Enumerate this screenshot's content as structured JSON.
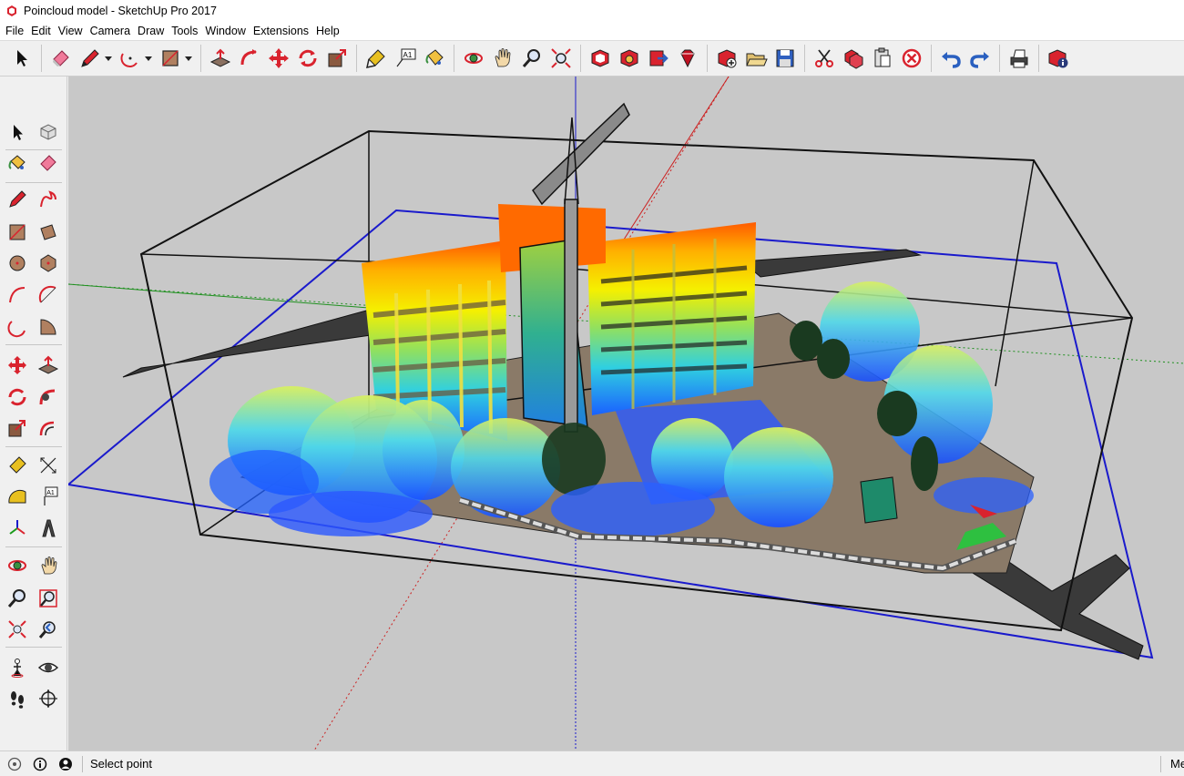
{
  "window": {
    "title": "Poincloud model - SketchUp Pro 2017"
  },
  "menu": [
    "File",
    "Edit",
    "View",
    "Camera",
    "Draw",
    "Tools",
    "Window",
    "Extensions",
    "Help"
  ],
  "toolbar": {
    "tools": [
      "select-icon",
      "eraser-icon",
      "pencil-icon",
      "arc-icon",
      "rectangle-icon",
      "push-pull-icon",
      "follow-me-icon",
      "move-icon",
      "rotate-icon",
      "scale-icon",
      "tape-measure-icon",
      "text-icon",
      "paint-bucket-icon",
      "orbit-icon",
      "pan-icon",
      "zoom-icon",
      "zoom-extents-icon",
      "3d-warehouse-icon",
      "extension-warehouse-icon",
      "share-model-icon",
      "ruby-icon",
      "new-icon",
      "open-icon",
      "save-icon",
      "cut-icon",
      "copy-icon",
      "paste-icon",
      "delete-icon",
      "undo-icon",
      "redo-icon",
      "print-icon",
      "model-info-icon"
    ],
    "text_tool_label": "A1"
  },
  "left_toolbar": {
    "text_tool_label": "A1"
  },
  "status": {
    "text": "Select point",
    "measurements_label": "Me"
  },
  "colors": {
    "accent_red": "#d9232e",
    "viewport_bg": "#c8c8c8",
    "axis_blue": "#1a1acc"
  }
}
